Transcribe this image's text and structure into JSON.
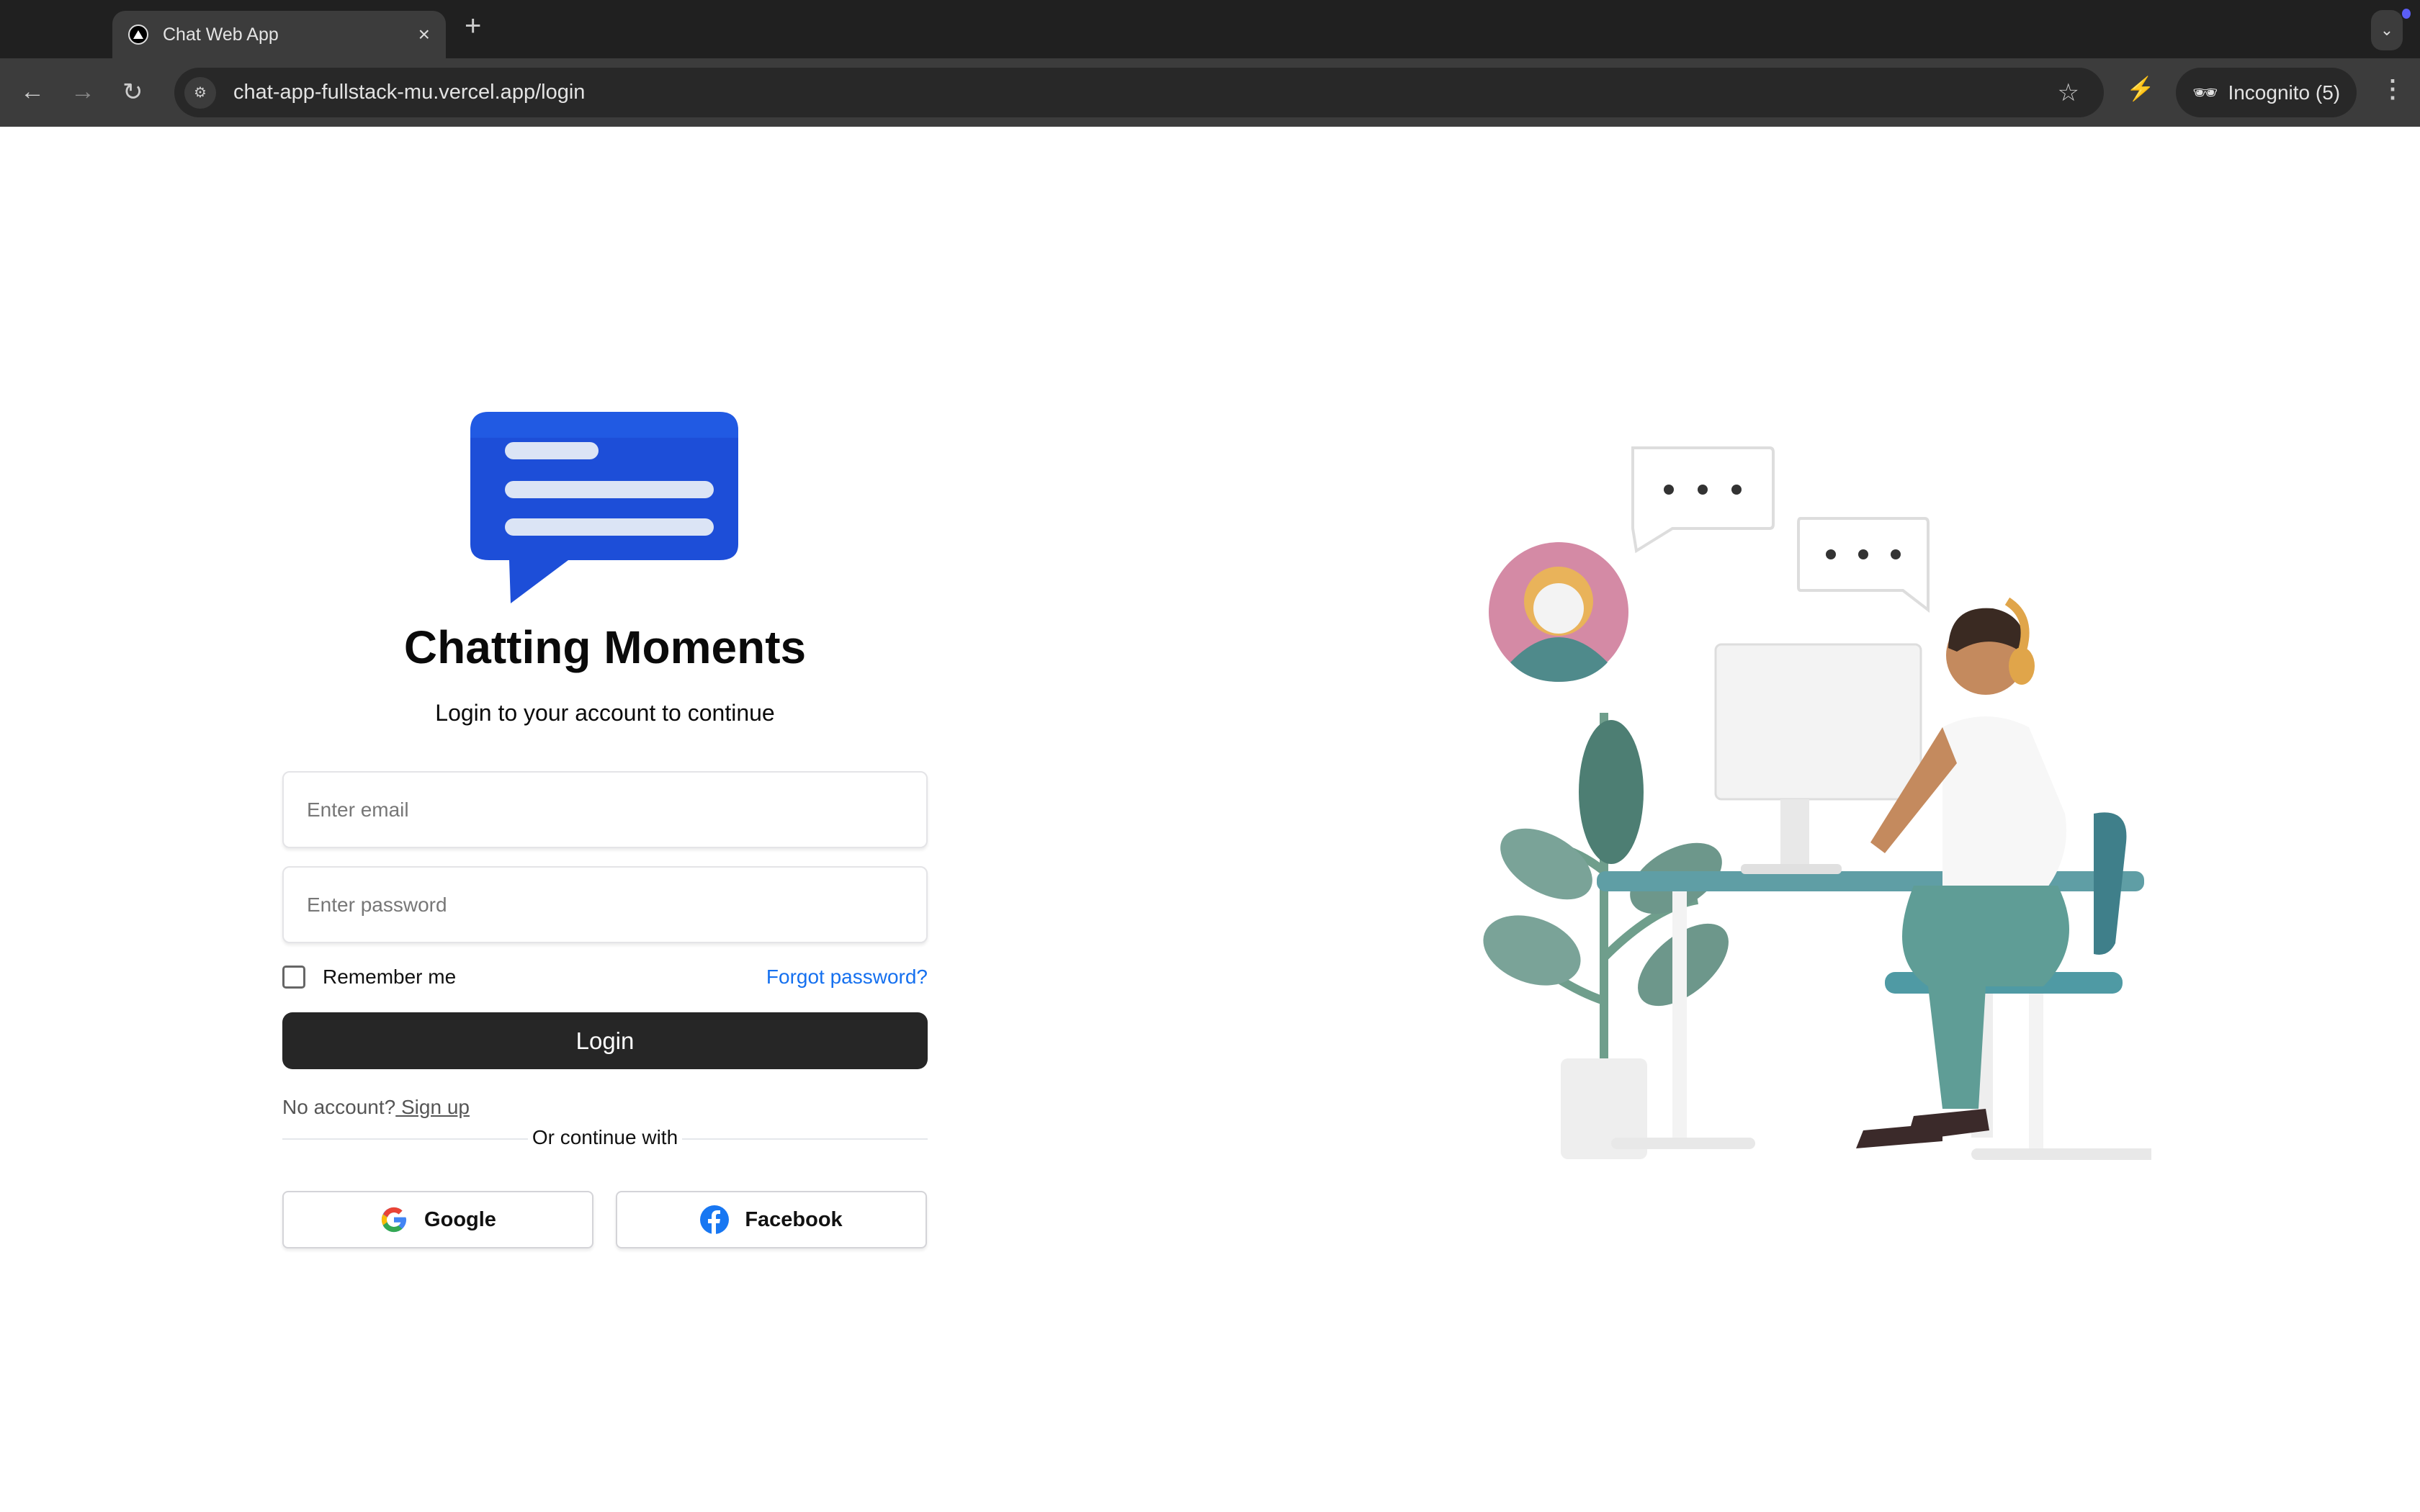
{
  "browser": {
    "tab_title": "Chat Web App",
    "tab_close": "×",
    "new_tab": "+",
    "url": "chat-app-fullstack-mu.vercel.app/login",
    "incognito_label": "Incognito (5)"
  },
  "app": {
    "title": "Chatting Moments",
    "subtitle": "Login to your account to continue",
    "email_placeholder": "Enter email",
    "password_placeholder": "Enter password",
    "remember_label": "Remember me",
    "forgot_label": "Forgot password?",
    "login_label": "Login",
    "no_account": "No account?",
    "signup_label": " Sign up",
    "or_continue": "Or continue with",
    "google_label": "Google",
    "facebook_label": "Facebook",
    "logo_color": "#1d4ed8"
  }
}
